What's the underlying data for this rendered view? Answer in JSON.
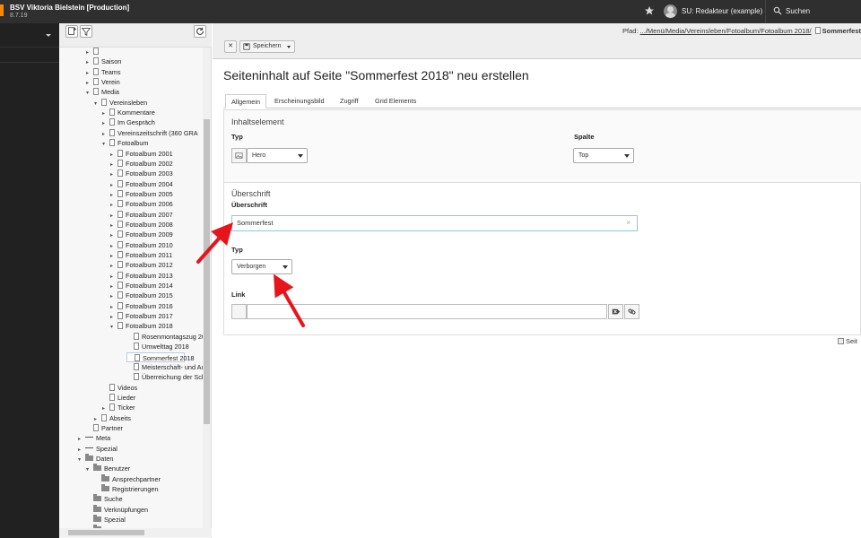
{
  "header": {
    "site_name": "BSV Viktoria Bielstein [Production]",
    "version": "8.7.19",
    "user": "SU: Redakteur (example)",
    "search_label": "Suchen"
  },
  "tree": {
    "nodes": [
      {
        "label": "",
        "toggle": "▸",
        "icon": "page"
      },
      {
        "label": "Saison",
        "toggle": "▸",
        "icon": "page"
      },
      {
        "label": "Teams",
        "toggle": "▸",
        "icon": "page"
      },
      {
        "label": "Verein",
        "toggle": "▸",
        "icon": "page"
      },
      {
        "label": "Media",
        "toggle": "▾",
        "icon": "page"
      },
      {
        "label": "Vereinsleben",
        "toggle": "▾",
        "icon": "page"
      },
      {
        "label": "Kommentare",
        "toggle": "▸",
        "icon": "page"
      },
      {
        "label": "Im Gespräch",
        "toggle": "▸",
        "icon": "page"
      },
      {
        "label": "Vereinszeitschrift (360 GRA",
        "toggle": "▸",
        "icon": "page"
      },
      {
        "label": "Fotoalbum",
        "toggle": "▾",
        "icon": "page"
      },
      {
        "label": "Fotoalbum 2001",
        "toggle": "▸",
        "icon": "page"
      },
      {
        "label": "Fotoalbum 2002",
        "toggle": "▸",
        "icon": "page"
      },
      {
        "label": "Fotoalbum 2003",
        "toggle": "▸",
        "icon": "page"
      },
      {
        "label": "Fotoalbum 2004",
        "toggle": "▸",
        "icon": "page"
      },
      {
        "label": "Fotoalbum 2005",
        "toggle": "▸",
        "icon": "page"
      },
      {
        "label": "Fotoalbum 2006",
        "toggle": "▸",
        "icon": "page"
      },
      {
        "label": "Fotoalbum 2007",
        "toggle": "▸",
        "icon": "page"
      },
      {
        "label": "Fotoalbum 2008",
        "toggle": "▸",
        "icon": "page"
      },
      {
        "label": "Fotoalbum 2009",
        "toggle": "▸",
        "icon": "page"
      },
      {
        "label": "Fotoalbum 2010",
        "toggle": "▸",
        "icon": "page"
      },
      {
        "label": "Fotoalbum 2011",
        "toggle": "▸",
        "icon": "page"
      },
      {
        "label": "Fotoalbum 2012",
        "toggle": "▸",
        "icon": "page"
      },
      {
        "label": "Fotoalbum 2013",
        "toggle": "▸",
        "icon": "page"
      },
      {
        "label": "Fotoalbum 2014",
        "toggle": "▸",
        "icon": "page"
      },
      {
        "label": "Fotoalbum 2015",
        "toggle": "▸",
        "icon": "page"
      },
      {
        "label": "Fotoalbum 2016",
        "toggle": "▸",
        "icon": "page"
      },
      {
        "label": "Fotoalbum 2017",
        "toggle": "▸",
        "icon": "page"
      },
      {
        "label": "Fotoalbum 2018",
        "toggle": "▾",
        "icon": "page"
      },
      {
        "label": "Rosenmontagszug 20",
        "toggle": "",
        "icon": "page"
      },
      {
        "label": "Umwelttag 2018",
        "toggle": "",
        "icon": "page"
      },
      {
        "label": "Sommerfest 2018",
        "toggle": "",
        "icon": "page"
      },
      {
        "label": "Meisterschaft- und Au",
        "toggle": "",
        "icon": "page"
      },
      {
        "label": "Überreichung der Sch",
        "toggle": "",
        "icon": "page"
      },
      {
        "label": "Videos",
        "toggle": "",
        "icon": "page"
      },
      {
        "label": "Lieder",
        "toggle": "",
        "icon": "page"
      },
      {
        "label": "Ticker",
        "toggle": "▸",
        "icon": "page"
      },
      {
        "label": "Abseits",
        "toggle": "▸",
        "icon": "page"
      },
      {
        "label": "Partner",
        "toggle": "",
        "icon": "page"
      },
      {
        "label": "Meta",
        "toggle": "▸",
        "icon": "sep"
      },
      {
        "label": "Spezial",
        "toggle": "▸",
        "icon": "sep"
      },
      {
        "label": "Daten",
        "toggle": "▾",
        "icon": "folder"
      },
      {
        "label": "Benutzer",
        "toggle": "▾",
        "icon": "folder"
      },
      {
        "label": "Ansprechpartner",
        "toggle": "",
        "icon": "folder"
      },
      {
        "label": "Registrierungen",
        "toggle": "",
        "icon": "folder"
      },
      {
        "label": "Suche",
        "toggle": "",
        "icon": "folder"
      },
      {
        "label": "Verknüpfungen",
        "toggle": "",
        "icon": "folder"
      },
      {
        "label": "Spezial",
        "toggle": "",
        "icon": "folder"
      },
      {
        "label": "",
        "toggle": "",
        "icon": "folder"
      }
    ]
  },
  "docheader": {
    "path_label": "Pfad:",
    "path_link": ".../Menü/Media/Vereinsleben/Fotoalbum/Fotoalbum 2018/",
    "path_page": "Sommerfest",
    "save_label": "Speichern"
  },
  "form": {
    "title": "Seiteninhalt auf Seite \"Sommerfest 2018\" neu erstellen",
    "tabs": [
      "Allgemein",
      "Erscheinungsbild",
      "Zugriff",
      "Grid Elements"
    ],
    "section1_legend": "Inhaltselement",
    "type_label": "Typ",
    "type_value": "Hero",
    "column_label": "Spalte",
    "column_value": "Top",
    "section2_legend": "Überschrift",
    "header_label": "Überschrift",
    "header_value": "Sommerfest",
    "header_type_label": "Typ",
    "header_type_value": "Verborgen",
    "link_label": "Link",
    "link_value": "",
    "save_info": "Seit"
  },
  "colors": {
    "topbar": "#2f2f2f",
    "module_menu": "#212121",
    "accent": "#ff8700",
    "arrow": "#e8141c",
    "input_focus_border": "#8fc4e8"
  }
}
